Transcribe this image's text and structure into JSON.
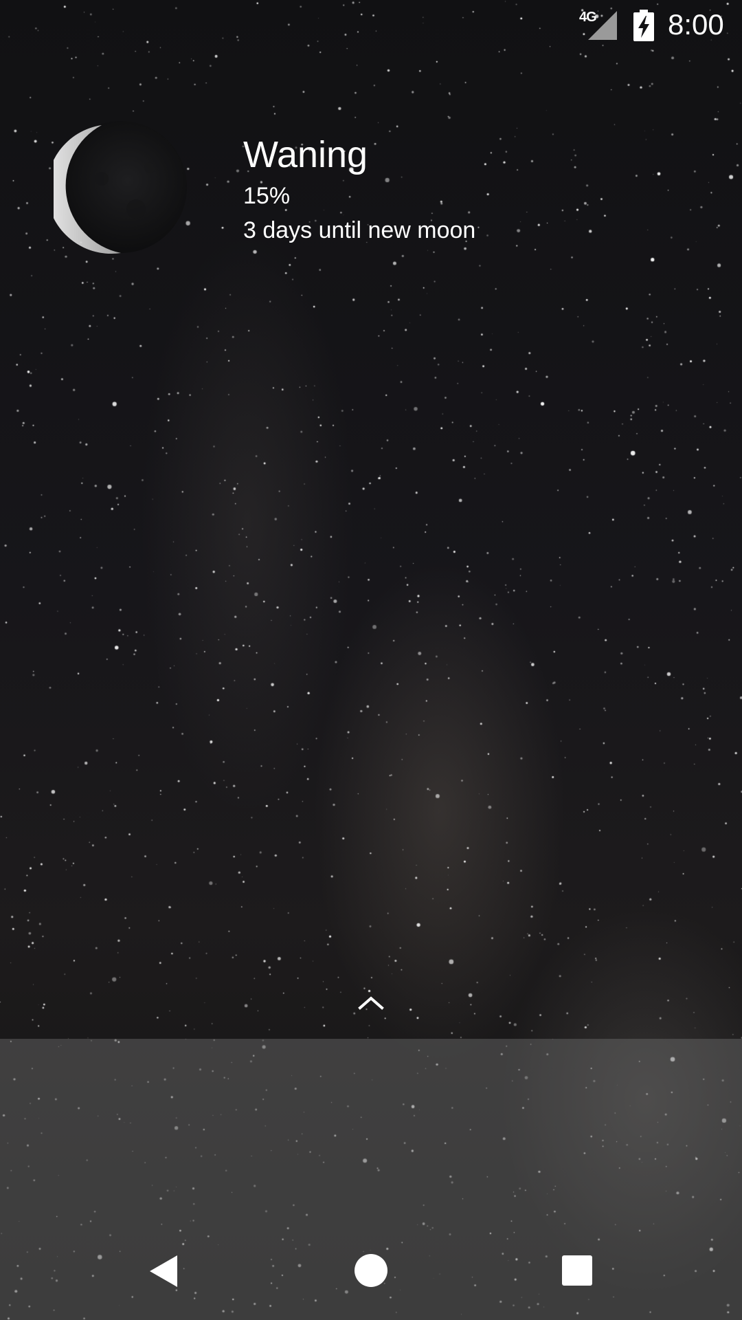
{
  "status_bar": {
    "network_type": "4G",
    "time": "8:00",
    "signal_icon": "cellular-signal-icon",
    "battery_icon": "battery-charging-icon"
  },
  "moon_widget": {
    "phase": "Waning",
    "illumination": "15%",
    "countdown": "3 days until new moon",
    "image_icon": "waning-crescent-moon-icon"
  },
  "swipe_hint": {
    "icon": "chevron-up-icon"
  },
  "nav_bar": {
    "back_icon": "back-triangle-icon",
    "home_icon": "home-circle-icon",
    "recents_icon": "recents-square-icon"
  },
  "colors": {
    "text": "#ffffff",
    "background": "#0d0d0f",
    "tray": "#6e6e6e"
  }
}
